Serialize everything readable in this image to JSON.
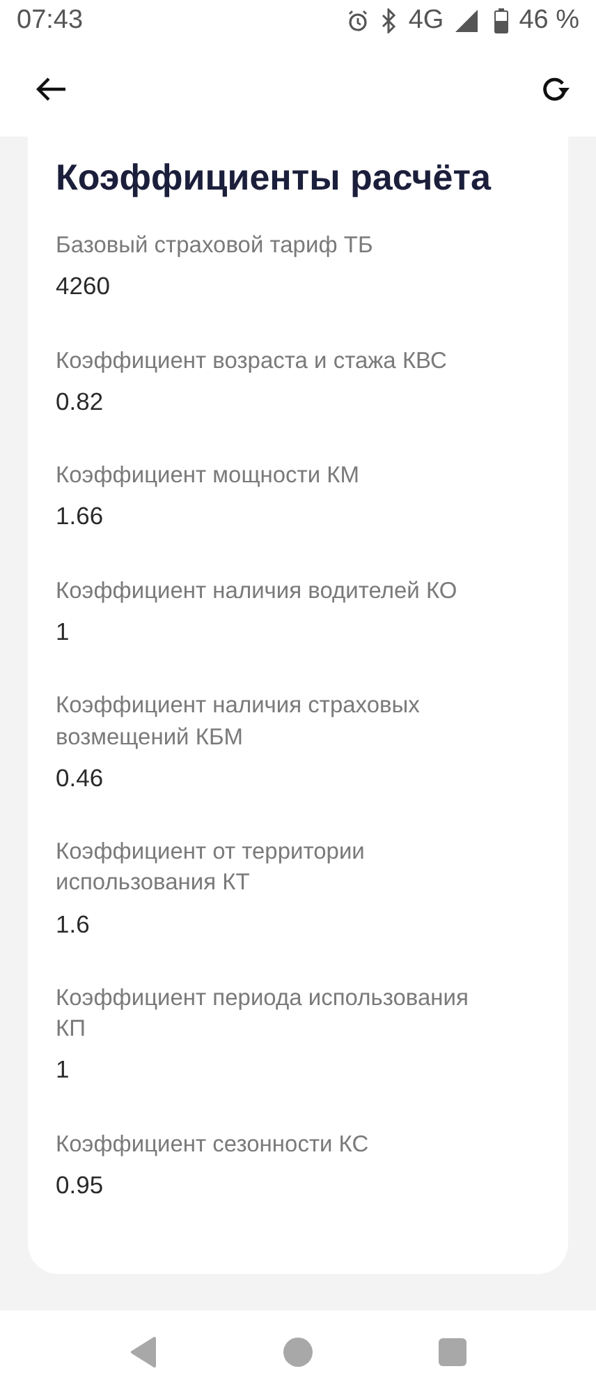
{
  "status_bar": {
    "time": "07:43",
    "network": "4G",
    "battery": "46 %"
  },
  "title": "Коэффициенты расчёта",
  "items": [
    {
      "label": "Базовый страховой тариф ТБ",
      "value": "4260"
    },
    {
      "label": "Коэффициент возраста и стажа КВС",
      "value": "0.82"
    },
    {
      "label": "Коэффициент мощности КМ",
      "value": "1.66"
    },
    {
      "label": "Коэффициент наличия водителей КО",
      "value": "1"
    },
    {
      "label": "Коэффициент наличия страховых возмещений КБМ",
      "value": "0.46"
    },
    {
      "label": "Коэффициент от территории использования КТ",
      "value": "1.6"
    },
    {
      "label": "Коэффициент периода использования КП",
      "value": "1"
    },
    {
      "label": "Коэффициент сезонности КС",
      "value": "0.95"
    }
  ]
}
